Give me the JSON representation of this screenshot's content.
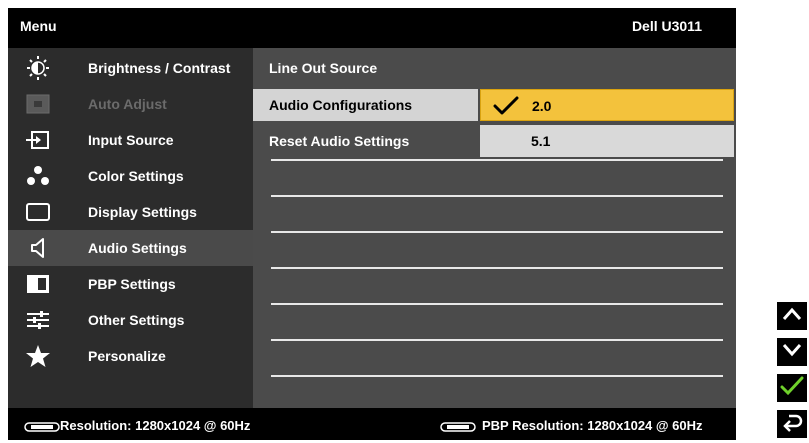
{
  "header": {
    "title": "Menu",
    "model": "Dell U3011"
  },
  "sidebar": {
    "items": [
      {
        "label": "Brightness / Contrast",
        "icon": "brightness-icon"
      },
      {
        "label": "Auto Adjust",
        "icon": "auto-adjust-icon",
        "disabled": true
      },
      {
        "label": "Input Source",
        "icon": "input-source-icon"
      },
      {
        "label": "Color Settings",
        "icon": "color-settings-icon"
      },
      {
        "label": "Display Settings",
        "icon": "display-settings-icon"
      },
      {
        "label": "Audio Settings",
        "icon": "speaker-icon",
        "active": true
      },
      {
        "label": "PBP Settings",
        "icon": "pbp-icon"
      },
      {
        "label": "Other Settings",
        "icon": "sliders-icon"
      },
      {
        "label": "Personalize",
        "icon": "star-icon"
      }
    ]
  },
  "submenu": {
    "items": [
      {
        "label": "Line Out Source"
      },
      {
        "label": "Audio Configurations",
        "selected": true
      },
      {
        "label": "Reset Audio Settings"
      }
    ],
    "options": [
      {
        "label": "2.0",
        "checked": true
      },
      {
        "label": "5.1",
        "checked": false
      }
    ]
  },
  "footer": {
    "resolution": "Resolution: 1280x1024 @ 60Hz",
    "pbp_resolution": "PBP Resolution: 1280x1024 @ 60Hz"
  },
  "side_buttons": [
    "up-arrow-icon",
    "down-arrow-icon",
    "checkmark-icon",
    "back-icon"
  ],
  "colors": {
    "selected_option": "#f3c23c",
    "checkmark_button": "#6fd12b"
  }
}
